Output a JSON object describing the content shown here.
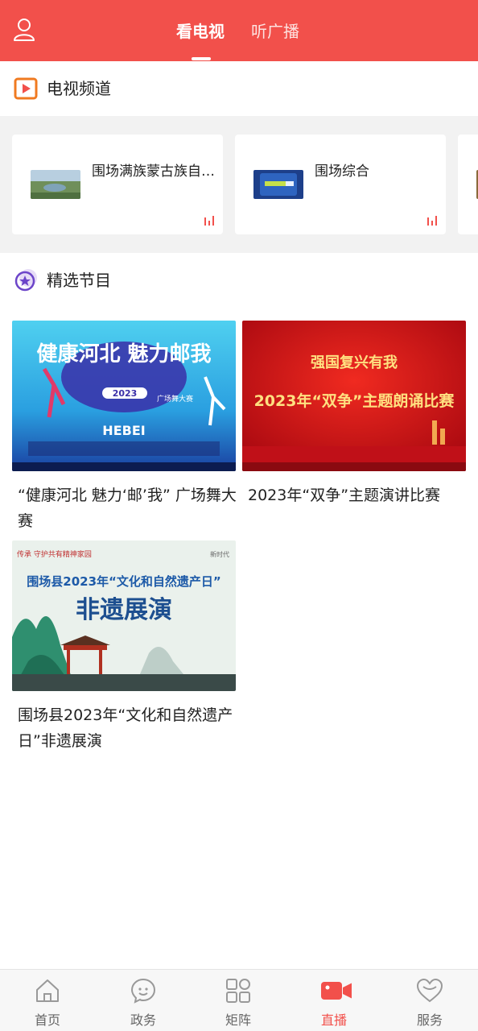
{
  "header": {
    "tabs": [
      {
        "label": "看电视",
        "active": true
      },
      {
        "label": "听广播",
        "active": false
      }
    ],
    "accent_color": "#f2504b"
  },
  "tv_section": {
    "title": "电视频道",
    "icon": "tv-play-icon",
    "channels": [
      {
        "name": "围场满族蒙古族自治县",
        "icon": "live-signal-icon"
      },
      {
        "name": "围场综合",
        "icon": "live-signal-icon"
      }
    ]
  },
  "featured_section": {
    "title": "精选节目",
    "icon": "star-badge-icon",
    "programs": [
      {
        "title": "“健康河北 魅力‘邮’我” 广场舞大赛",
        "poster": {
          "headline": "健康河北 魅力邮我",
          "year": "2023",
          "subtitle": "广场舞大赛",
          "brand": "HEBEI"
        }
      },
      {
        "title": "2023年“双争”主题演讲比赛",
        "poster": {
          "top": "强国复兴有我",
          "headline": "2023年“双争”主题朗诵比赛"
        }
      },
      {
        "title": "围场县2023年“文化和自然遗产日”非遗展演",
        "poster": {
          "top": "传承  守护共有精神家园",
          "headline": "围场县2023年“文化和自然遗产日”",
          "subtitle": "非遗展演",
          "corner": "新时代"
        }
      }
    ]
  },
  "bottom_nav": [
    {
      "label": "首页",
      "icon": "home-icon",
      "active": false
    },
    {
      "label": "政务",
      "icon": "chat-bubble-icon",
      "active": false
    },
    {
      "label": "矩阵",
      "icon": "grid-icon",
      "active": false
    },
    {
      "label": "直播",
      "icon": "video-camera-icon",
      "active": true
    },
    {
      "label": "服务",
      "icon": "heart-icon",
      "active": false
    }
  ]
}
